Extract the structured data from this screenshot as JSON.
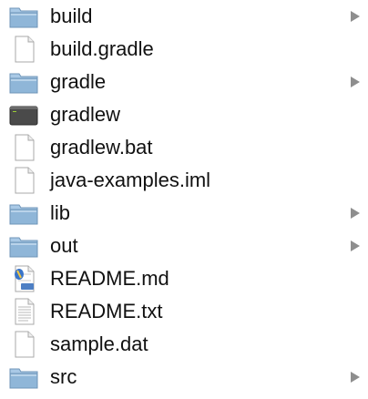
{
  "finder": {
    "items": [
      {
        "name": "build",
        "icon": "folder-icon",
        "expandable": true
      },
      {
        "name": "build.gradle",
        "icon": "document-icon",
        "expandable": false
      },
      {
        "name": "gradle",
        "icon": "folder-icon",
        "expandable": true
      },
      {
        "name": "gradlew",
        "icon": "terminal-executable-icon",
        "expandable": false
      },
      {
        "name": "gradlew.bat",
        "icon": "document-icon",
        "expandable": false
      },
      {
        "name": "java-examples.iml",
        "icon": "document-icon",
        "expandable": false
      },
      {
        "name": "lib",
        "icon": "folder-icon",
        "expandable": true
      },
      {
        "name": "out",
        "icon": "folder-icon",
        "expandable": true
      },
      {
        "name": "README.md",
        "icon": "text-document-icon",
        "expandable": false
      },
      {
        "name": "README.txt",
        "icon": "lined-document-icon",
        "expandable": false
      },
      {
        "name": "sample.dat",
        "icon": "document-icon",
        "expandable": false
      },
      {
        "name": "src",
        "icon": "folder-icon",
        "expandable": true
      }
    ],
    "colors": {
      "folder": "#8fb6d8",
      "folder_tab": "#a9c9e6",
      "terminal": "#4a4a4a",
      "disclosure": "#8e8e8e"
    }
  }
}
